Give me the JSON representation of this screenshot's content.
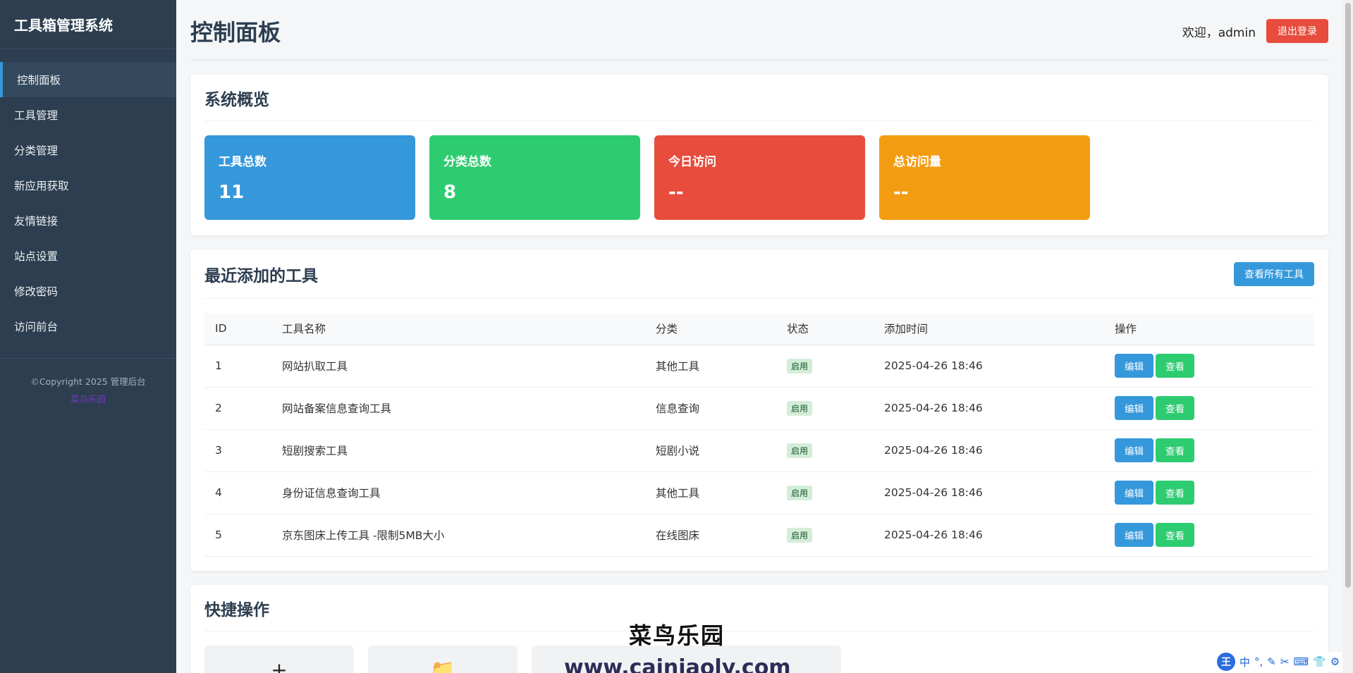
{
  "sidebar": {
    "brand": "工具箱管理系统",
    "items": [
      {
        "label": "控制面板",
        "active": true
      },
      {
        "label": "工具管理"
      },
      {
        "label": "分类管理"
      },
      {
        "label": "新应用获取"
      },
      {
        "label": "友情链接"
      },
      {
        "label": "站点设置"
      },
      {
        "label": "修改密码"
      },
      {
        "label": "访问前台"
      }
    ],
    "copyright": "©Copyright 2025 管理后台",
    "copyright_link": "菜鸟乐园"
  },
  "header": {
    "title": "控制面板",
    "welcome": "欢迎，admin",
    "logout_label": "退出登录"
  },
  "overview": {
    "title": "系统概览",
    "stats": [
      {
        "label": "工具总数",
        "value": "11",
        "color": "#3498db"
      },
      {
        "label": "分类总数",
        "value": "8",
        "color": "#2ecc71"
      },
      {
        "label": "今日访问",
        "value": "--",
        "color": "#e74c3c"
      },
      {
        "label": "总访问量",
        "value": "--",
        "color": "#f39c12"
      }
    ]
  },
  "recent": {
    "title": "最近添加的工具",
    "view_all_label": "查看所有工具",
    "columns": [
      "ID",
      "工具名称",
      "分类",
      "状态",
      "添加时间",
      "操作"
    ],
    "edit_label": "编辑",
    "view_label": "查看",
    "rows": [
      {
        "id": "1",
        "name": "网站扒取工具",
        "category": "其他工具",
        "status": "启用",
        "time": "2025-04-26 18:46"
      },
      {
        "id": "2",
        "name": "网站备案信息查询工具",
        "category": "信息查询",
        "status": "启用",
        "time": "2025-04-26 18:46"
      },
      {
        "id": "3",
        "name": "短剧搜索工具",
        "category": "短剧小说",
        "status": "启用",
        "time": "2025-04-26 18:46"
      },
      {
        "id": "4",
        "name": "身份证信息查询工具",
        "category": "其他工具",
        "status": "启用",
        "time": "2025-04-26 18:46"
      },
      {
        "id": "5",
        "name": "京东图床上传工具 -限制5MB大小",
        "category": "在线图床",
        "status": "启用",
        "time": "2025-04-26 18:46"
      }
    ]
  },
  "quick": {
    "title": "快捷操作",
    "tiles": [
      {
        "icon": "plus-icon",
        "glyph": "+"
      },
      {
        "icon": "folder-icon",
        "glyph": "📁"
      },
      {
        "icon": "blank-tile",
        "glyph": ""
      }
    ]
  },
  "watermark": {
    "title": "菜鸟乐园",
    "url": "www.cainiaoly.com"
  },
  "ime": {
    "logo": "王",
    "mode": "中",
    "items": [
      "°,",
      "✎",
      "✂",
      "⌨",
      "👕",
      "⚙"
    ]
  }
}
